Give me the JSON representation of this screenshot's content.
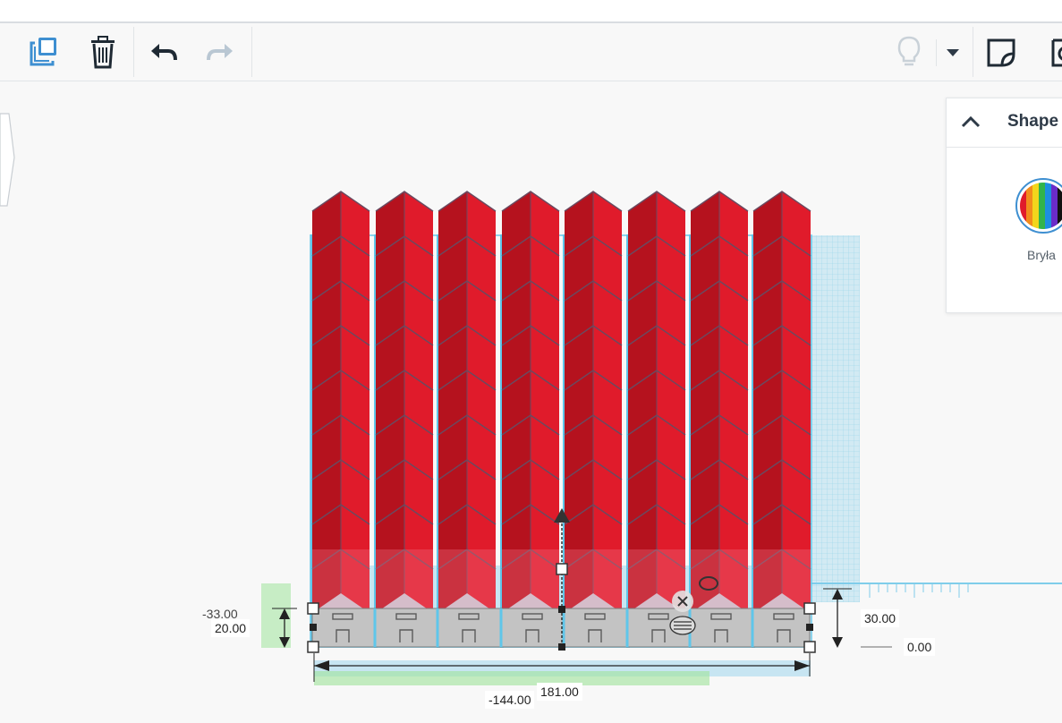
{
  "toolbar": {
    "tools": [
      "copy-icon",
      "trash-icon",
      "undo-icon",
      "redo-icon",
      "lightbulb-icon",
      "chevron-down-icon",
      "note-icon",
      "view-icon"
    ]
  },
  "shape_panel": {
    "title": "Shape",
    "swatch_label": "Bryła"
  },
  "dimensions": {
    "height_under": "-33.00",
    "height": "20.00",
    "elevation_top": "30.00",
    "elevation": "0.00",
    "width": "181.00",
    "x_position": "-144.00"
  },
  "colors": {
    "shape_red": "#e01b2b",
    "shape_dark": "#b5121e",
    "base_gray": "#c3c3c3",
    "workplane_blue": "#7fcdea",
    "accent_blue": "#3e8fd1"
  }
}
